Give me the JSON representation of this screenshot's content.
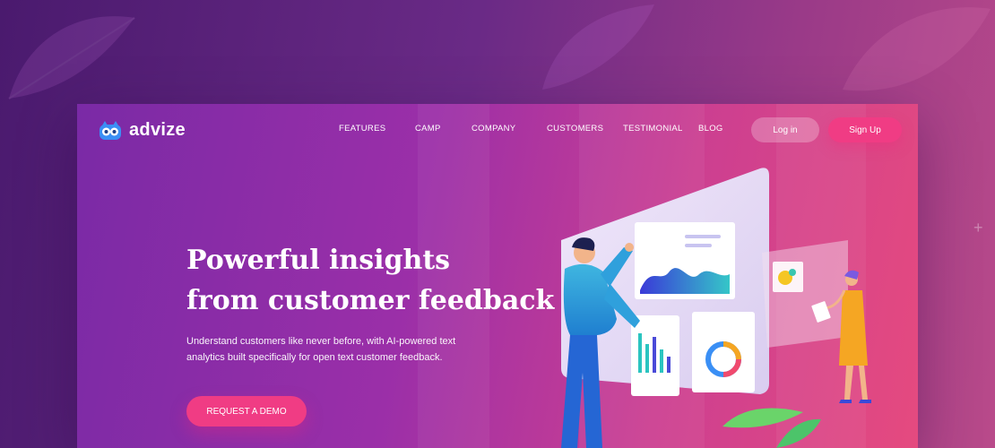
{
  "brand": {
    "name": "advize"
  },
  "nav": {
    "items": [
      {
        "label": "FEATURES"
      },
      {
        "label": "CAMP"
      },
      {
        "label": "COMPANY"
      },
      {
        "label": "CUSTOMERS"
      },
      {
        "label": "TESTIMONIAL"
      },
      {
        "label": "BLOG"
      }
    ],
    "login_label": "Log in",
    "signup_label": "Sign Up"
  },
  "hero": {
    "title_line1": "Powerful insights",
    "title_line2": "from customer feedback",
    "subtitle_line1": "Understand customers like never before, with AI-powered text",
    "subtitle_line2": "analytics built specifically for open text customer feedback.",
    "cta_label": "REQUEST A DEMO"
  },
  "colors": {
    "accent": "#f03c84",
    "logo_blue": "#3a8ff5",
    "background": "#6a2a86"
  },
  "icons": {
    "logo": "owl-logo-icon",
    "decor": "plus-icon"
  }
}
